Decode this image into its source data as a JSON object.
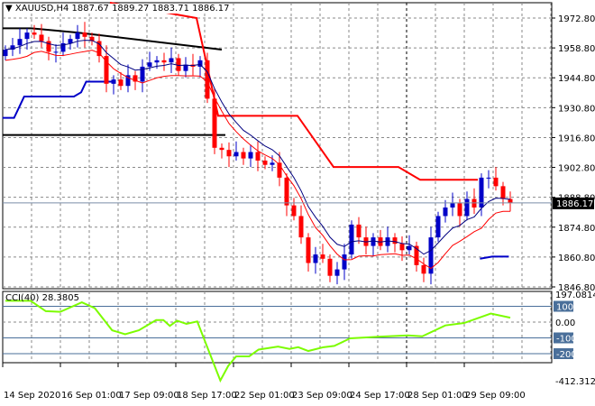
{
  "header": {
    "symbol": "XAUUSD,H4",
    "ohlc": "1887.67 1889.27 1883.71 1886.17"
  },
  "colors": {
    "bull": "#0000c8",
    "bear": "#ff0000",
    "ma": "#000080",
    "cci": "#7cfc00",
    "level": "#4a6f9a"
  },
  "price_axis": {
    "labels": [
      "1972.80",
      "1958.80",
      "1944.80",
      "1930.80",
      "1916.80",
      "1902.80",
      "1888.80",
      "1874.80",
      "1860.80",
      "1846.80"
    ],
    "current": "1886.17"
  },
  "cci": {
    "title": "CCI(40) 28.3805",
    "axis": [
      "197.0814",
      "100",
      "0.00",
      "-100",
      "-200",
      "-412.3125"
    ],
    "values": [
      [
        0,
        135
      ],
      [
        3.5,
        135
      ],
      [
        5.6,
        69
      ],
      [
        7.6,
        65
      ],
      [
        10.6,
        125
      ],
      [
        12.4,
        88
      ],
      [
        14.8,
        -52
      ],
      [
        16.6,
        -77
      ],
      [
        18.5,
        -52
      ],
      [
        20.9,
        13
      ],
      [
        21.9,
        13
      ],
      [
        22.8,
        -24
      ],
      [
        23.8,
        9
      ],
      [
        25.1,
        -11
      ],
      [
        26.6,
        4
      ],
      [
        29.8,
        -370
      ],
      [
        30.9,
        -277
      ],
      [
        32,
        -217
      ],
      [
        33.8,
        -217
      ],
      [
        35.1,
        -174
      ],
      [
        37.8,
        -155
      ],
      [
        39.4,
        -170
      ],
      [
        40.6,
        -159
      ],
      [
        42,
        -183
      ],
      [
        44.1,
        -159
      ],
      [
        45.6,
        -151
      ],
      [
        47.8,
        -103
      ],
      [
        52,
        -92
      ],
      [
        55.8,
        -84
      ],
      [
        57.8,
        -90
      ],
      [
        61,
        -21
      ],
      [
        63.6,
        -6
      ],
      [
        67.3,
        54
      ],
      [
        70,
        28
      ]
    ]
  },
  "time_axis": [
    "14 Sep 2020",
    "16 Sep 01:00",
    "17 Sep 09:00",
    "18 Sep 17:00",
    "22 Sep 01:00",
    "23 Sep 09:00",
    "24 Sep 17:00",
    "28 Sep 01:00",
    "29 Sep 09:00"
  ],
  "candles": {
    "first_open": 1955,
    "closes": [
      1958,
      1960,
      1963,
      1966,
      1965,
      1962,
      1957,
      1957,
      1961,
      1963,
      1966,
      1964,
      1962,
      1955,
      1942,
      1944,
      1941,
      1946,
      1943,
      1950,
      1952,
      1953,
      1952,
      1954,
      1948,
      1951,
      1950,
      1953,
      1935,
      1912,
      1911,
      1908,
      1910,
      1907,
      1910,
      1906,
      1904,
      1905,
      1898,
      1885,
      1880,
      1870,
      1858,
      1862,
      1860,
      1852,
      1855,
      1862,
      1876,
      1870,
      1866,
      1870,
      1866,
      1870,
      1867,
      1864,
      1866,
      1857,
      1853,
      1870,
      1880,
      1884,
      1886,
      1880,
      1888,
      1884,
      1898,
      1898,
      1894,
      1888,
      1886.17
    ]
  },
  "red_step": [
    [
      14.5,
      1980
    ],
    [
      26.5,
      1972.8
    ],
    [
      29.5,
      1927
    ],
    [
      40.5,
      1927
    ],
    [
      45.5,
      1903
    ],
    [
      54.5,
      1903
    ],
    [
      57.5,
      1897
    ],
    [
      65.5,
      1897
    ]
  ],
  "blue_step": [
    [
      -0.4,
      1926
    ],
    [
      1.2,
      1926
    ],
    [
      2.6,
      1936
    ],
    [
      9.5,
      1936
    ],
    [
      10.5,
      1938
    ],
    [
      11.2,
      1943
    ],
    [
      15,
      1943
    ]
  ],
  "blue_step2": [
    [
      65.8,
      1860
    ],
    [
      67.5,
      1861
    ],
    [
      69.8,
      1861
    ]
  ],
  "black_line": [
    [
      -0.4,
      1968
    ],
    [
      3.6,
      1968
    ],
    [
      10,
      1966
    ],
    [
      30,
      1958
    ]
  ],
  "black_hline": 1918
}
